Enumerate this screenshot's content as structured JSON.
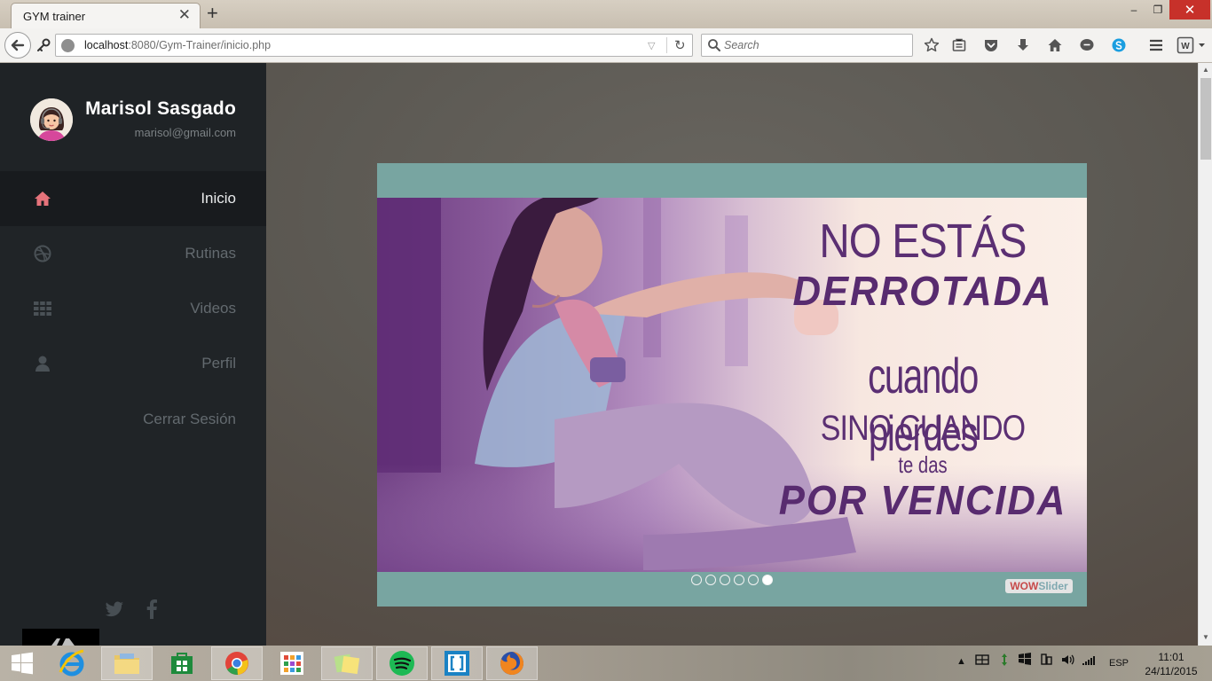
{
  "browser": {
    "tab_title": "GYM trainer",
    "tab_close": "✕",
    "new_tab": "+",
    "url_host": "localhost",
    "url_rest": ":8080/Gym-Trainer/inicio.php",
    "search_placeholder": "Search",
    "window_minimize": "–",
    "window_maximize": "❐",
    "window_close": "✕"
  },
  "profile": {
    "name": "Marisol Sasgado",
    "email": "marisol@gmail.com"
  },
  "menu": {
    "items": [
      {
        "label": "Inicio",
        "icon": "home-icon"
      },
      {
        "label": "Rutinas",
        "icon": "dribbble-icon"
      },
      {
        "label": "Videos",
        "icon": "grid-icon"
      },
      {
        "label": "Perfil",
        "icon": "user-icon"
      },
      {
        "label": "Cerrar Sesión",
        "icon": ""
      }
    ],
    "active_index": 0
  },
  "slider": {
    "lines": [
      "NO ESTÁS",
      "DERROTADA",
      "cuando pierdes",
      "SINO CUANDO",
      "te das",
      "POR VENCIDA"
    ],
    "dot_count": 6,
    "active_dot": 5,
    "badge_a": "WOW",
    "badge_b": "Slider"
  },
  "taskbar": {
    "lang": "ESP",
    "time": "11:01",
    "date": "24/11/2015"
  },
  "colors": {
    "sidebar_bg": "#202427",
    "active_icon": "#e5737b",
    "slider_frame": "#78a5a1",
    "text_purple": "#5b2f73"
  }
}
